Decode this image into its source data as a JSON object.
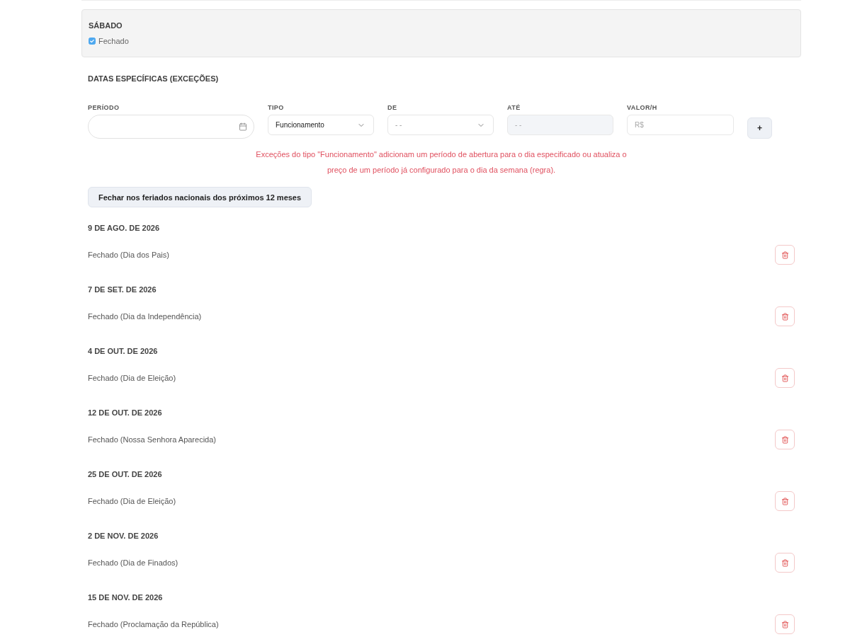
{
  "day_card": {
    "title": "SÁBADO",
    "closed": {
      "label": "Fechado",
      "checked": true
    }
  },
  "exceptions": {
    "title": "DATAS ESPECÍFICAS (EXCEÇÕES)",
    "form": {
      "fields": [
        {
          "kind": "date",
          "label": "PERÍODO"
        },
        {
          "kind": "select",
          "label": "TIPO",
          "value": "Funcionamento"
        },
        {
          "kind": "select",
          "label": "DE",
          "placeholder": "- -"
        },
        {
          "kind": "input",
          "label": "ATÉ",
          "placeholder": "- -",
          "disabled": true
        },
        {
          "kind": "input",
          "label": "VALOR/H",
          "placeholder": "R$",
          "disabled": false
        }
      ],
      "add_button": "+"
    },
    "hint": "Exceções do tipo \"Funcionamento\" adicionam um período de abertura para o dia especificado ou atualiza o preço de um período já configurado para o dia da semana (regra).",
    "holidays_button": "Fechar nos feriados nacionais dos próximos 12 meses",
    "entries": [
      {
        "date": "9 DE AGO. DE 2026",
        "description": "Fechado (Dia dos Pais)"
      },
      {
        "date": "7 DE SET. DE 2026",
        "description": "Fechado (Dia da Independência)"
      },
      {
        "date": "4 DE OUT. DE 2026",
        "description": "Fechado (Dia de Eleição)"
      },
      {
        "date": "12 DE OUT. DE 2026",
        "description": "Fechado (Nossa Senhora Aparecida)"
      },
      {
        "date": "25 DE OUT. DE 2026",
        "description": "Fechado (Dia de Eleição)"
      },
      {
        "date": "2 DE NOV. DE 2026",
        "description": "Fechado (Dia de Finados)"
      },
      {
        "date": "15 DE NOV. DE 2026",
        "description": "Fechado (Proclamação da República)"
      }
    ]
  }
}
